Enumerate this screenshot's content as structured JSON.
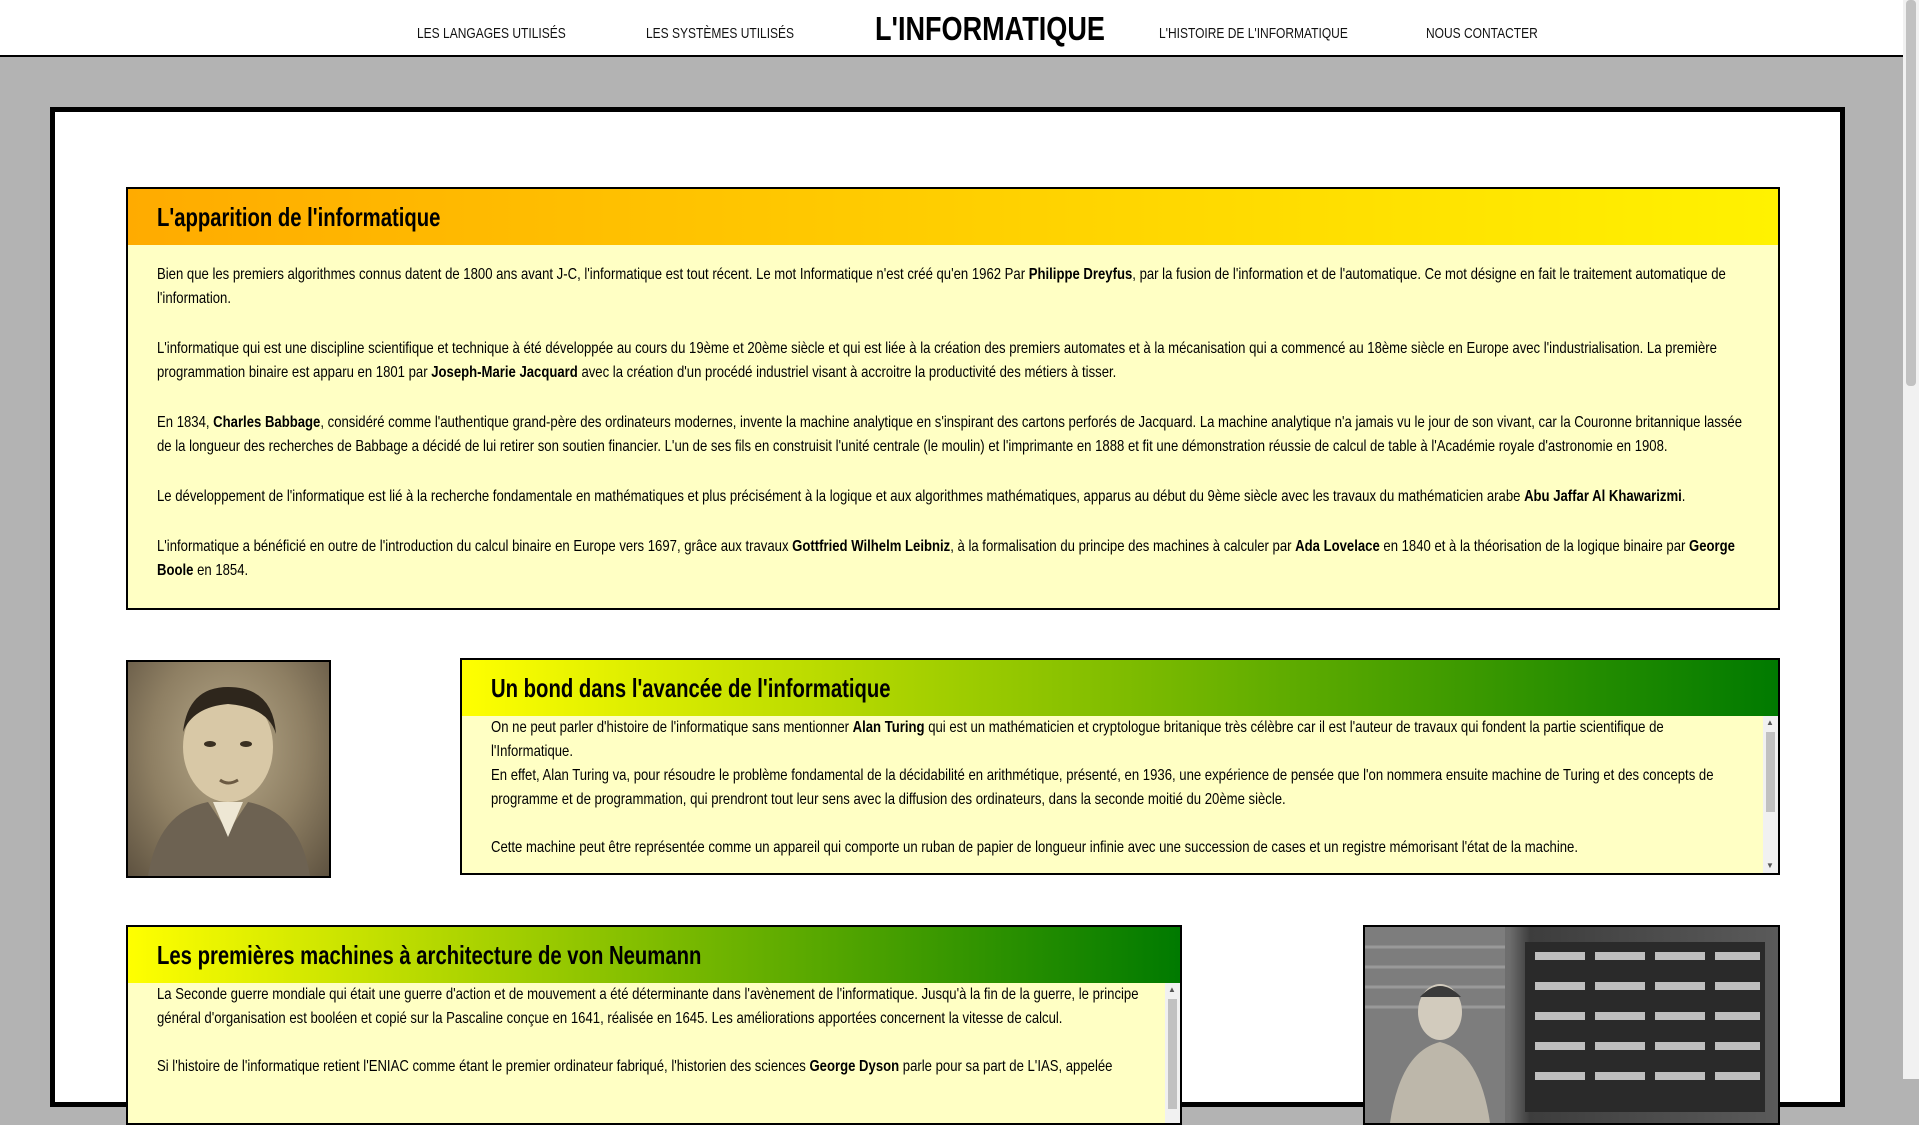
{
  "nav": {
    "links": [
      "LES LANGAGES UTILISÉS",
      "LES SYSTÈMES UTILISÉS",
      "L'HISTOIRE DE L'INFORMATIQUE",
      "NOUS CONTACTER"
    ],
    "brand": "L'INFORMATIQUE"
  },
  "section1": {
    "title": "L'apparition de l'informatique",
    "p1a": "Bien que les premiers algorithmes connus datent de 1800 ans avant J-C, l'informatique est tout récent. Le mot Informatique n'est créé qu'en 1962 Par ",
    "p1b": "Philippe Dreyfus",
    "p1c": ", par la fusion de l'information et de l'automatique. Ce mot désigne en fait le traitement automatique de l'information.",
    "p2a": "L'informatique qui est une discipline scientifique et technique à été développée au cours du 19ème et 20ème siècle et qui est liée à la création des premiers automates et à la mécanisation qui a commencé au 18ème siècle en Europe avec l'industrialisation. La première programmation binaire est apparu en 1801 par ",
    "p2b": "Joseph-Marie Jacquard",
    "p2c": " avec la création d'un procédé industriel visant à accroitre la productivité des métiers à tisser.",
    "p3a": "En 1834, ",
    "p3b": "Charles Babbage",
    "p3c": ", considéré comme l'authentique grand-père des ordinateurs modernes, invente la machine analytique en s'inspirant des cartons perforés de Jacquard. La machine analytique n'a jamais vu le jour de son vivant, car la Couronne britannique lassée de la longueur des recherches de Babbage a décidé de lui retirer son soutien financier. L'un de ses fils en construisit l'unité centrale (le moulin) et l'imprimante en 1888 et fit une démonstration réussie de calcul de table à l'Académie royale d'astronomie en 1908.",
    "p4a": "Le développement de l'informatique est lié à la recherche fondamentale en mathématiques et plus précisément à la logique et aux algorithmes mathématiques, apparus au début du 9ème siècle avec les travaux du mathématicien arabe ",
    "p4b": "Abu Jaffar Al Khawarizmi",
    "p4c": ".",
    "p5a": "L'informatique a bénéficié en outre de l'introduction du calcul binaire en Europe vers 1697, grâce aux travaux ",
    "p5b": "Gottfried Wilhelm Leibniz",
    "p5c": ", à la formalisation du principe des machines à calculer par ",
    "p5d": "Ada Lovelace",
    "p5e": " en 1840 et à la théorisation de la logique binaire par ",
    "p5f": "George Boole",
    "p5g": " en 1854."
  },
  "section2": {
    "title": "Un bond dans l'avancée de l'informatique",
    "p1a": "On ne peut parler d'histoire de l'informatique sans mentionner ",
    "p1b": "Alan Turing",
    "p1c": " qui est un mathématicien et cryptologue britanique très célèbre car il est l'auteur de travaux qui fondent la partie scientifique de l'Informatique.",
    "p2": "En effet, Alan Turing va, pour résoudre le problème fondamental de la décidabilité en arithmétique, présenté, en 1936, une expérience de pensée que l'on nommera ensuite machine de Turing et des concepts de programme et de programmation, qui prendront tout leur sens avec la diffusion des ordinateurs, dans la seconde moitié du 20ème siècle.",
    "p3": "Cette machine peut être représentée comme un appareil qui comporte un ruban de papier de longueur infinie avec une succession de cases et un registre mémorisant l'état de la machine."
  },
  "section3": {
    "title": "Les premières machines à architecture de von Neumann",
    "p1": "La Seconde guerre mondiale qui était une guerre d'action et de mouvement a été déterminante dans l'avènement de l'informatique. Jusqu'à la fin de la guerre, le principe général d'organisation est booléen et copié sur la Pascaline conçue en 1641, réalisée en 1645. Les améliorations apportées concernent la vitesse de calcul.",
    "p2a": "Si l'histoire de l'informatique retient l'ENIAC comme étant le premier ordinateur fabriqué, l'historien des sciences ",
    "p2b": "George Dyson",
    "p2c": " parle pour sa part de L'IAS, appelée"
  },
  "icons": {
    "scroll_up": "▲",
    "scroll_down": "▼"
  }
}
